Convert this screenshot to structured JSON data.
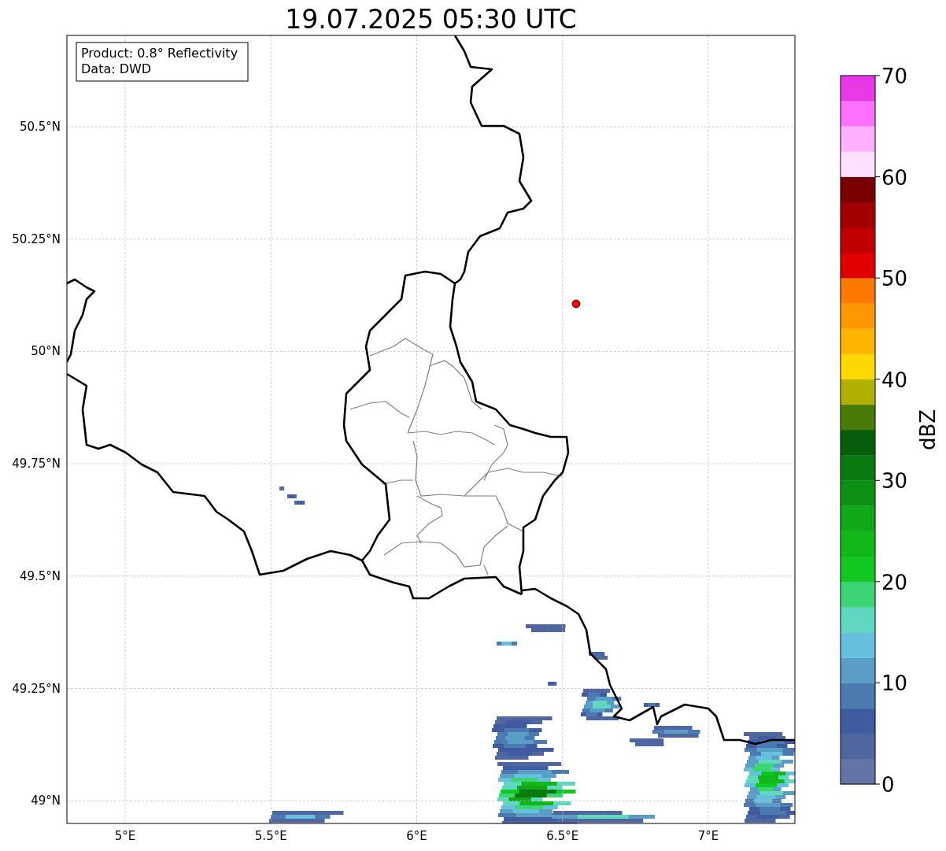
{
  "title": "19.07.2025 05:30 UTC",
  "info_box": [
    "Product: 0.8° Reflectivity",
    "Data: DWD"
  ],
  "map": {
    "lat_ticks": [
      "50.5°N",
      "50.25°N",
      "50°N",
      "49.75°N",
      "49.5°N",
      "49.25°N",
      "49°N"
    ],
    "lon_ticks": [
      "5°E",
      "5.5°E",
      "6°E",
      "6.5°E",
      "7°E"
    ]
  },
  "colorbar": {
    "label": "dBZ",
    "ticks": [
      "70",
      "60",
      "50",
      "40",
      "30",
      "20",
      "10",
      "0"
    ],
    "bins": [
      {
        "color": "#6574a6"
      },
      {
        "color": "#5066a0"
      },
      {
        "color": "#405ba0"
      },
      {
        "color": "#4a7ab0"
      },
      {
        "color": "#5a9ec8"
      },
      {
        "color": "#66c0dd"
      },
      {
        "color": "#60d8c0"
      },
      {
        "color": "#3cd474"
      },
      {
        "color": "#10c820"
      },
      {
        "color": "#10b818"
      },
      {
        "color": "#10a818"
      },
      {
        "color": "#0c9014"
      },
      {
        "color": "#0a7a10"
      },
      {
        "color": "#065e0c"
      },
      {
        "color": "#4a7a0a"
      },
      {
        "color": "#b0b000"
      },
      {
        "color": "#ffd800"
      },
      {
        "color": "#ffb400"
      },
      {
        "color": "#ff9800"
      },
      {
        "color": "#ff7800"
      },
      {
        "color": "#e00000"
      },
      {
        "color": "#c00000"
      },
      {
        "color": "#a00000"
      },
      {
        "color": "#780000"
      },
      {
        "color": "#ffe0ff"
      },
      {
        "color": "#ffb0ff"
      },
      {
        "color": "#ff70ff"
      },
      {
        "color": "#e838e8"
      }
    ]
  }
}
